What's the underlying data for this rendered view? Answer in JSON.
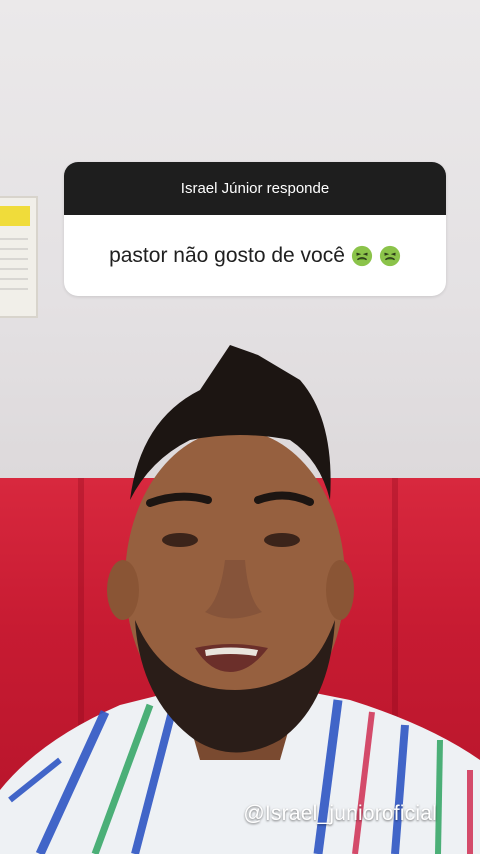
{
  "question_card": {
    "header": "Israel Júnior responde",
    "question_text": "pastor não gosto de você",
    "emojis": [
      "nauseated-face",
      "nauseated-face"
    ]
  },
  "overlay": {
    "handle": "@Israel_junioroficial"
  },
  "colors": {
    "card_header": "#1e1e1e",
    "card_body": "#ffffff",
    "sofa_red": "#c71b32",
    "wall": "#e6e3e4"
  }
}
